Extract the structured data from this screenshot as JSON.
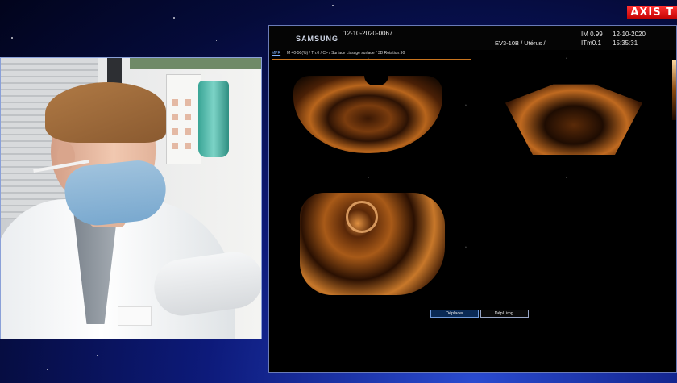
{
  "broadcast": {
    "logo_text": "AXIS T"
  },
  "ultrasound": {
    "brand": "SAMSUNG",
    "patient_id": "12-10-2020-0067",
    "probe": "EV3-10B / Utérus /",
    "index_line1": "IM  0.99",
    "index_line2": "ITm0.1",
    "date": "12-10-2020",
    "time": "15:35:31",
    "mode_tag": "MPR",
    "params": "M 40-50(%) / Th:0 / C> / Surface Lissage surface / 3D Rotation:90",
    "buttons": {
      "move": "Déplacer",
      "image": "Dépl. img."
    }
  },
  "colors": {
    "accent_orange": "#c8741e",
    "frame_blue": "#6b7cb8",
    "logo_red": "#e00000"
  }
}
